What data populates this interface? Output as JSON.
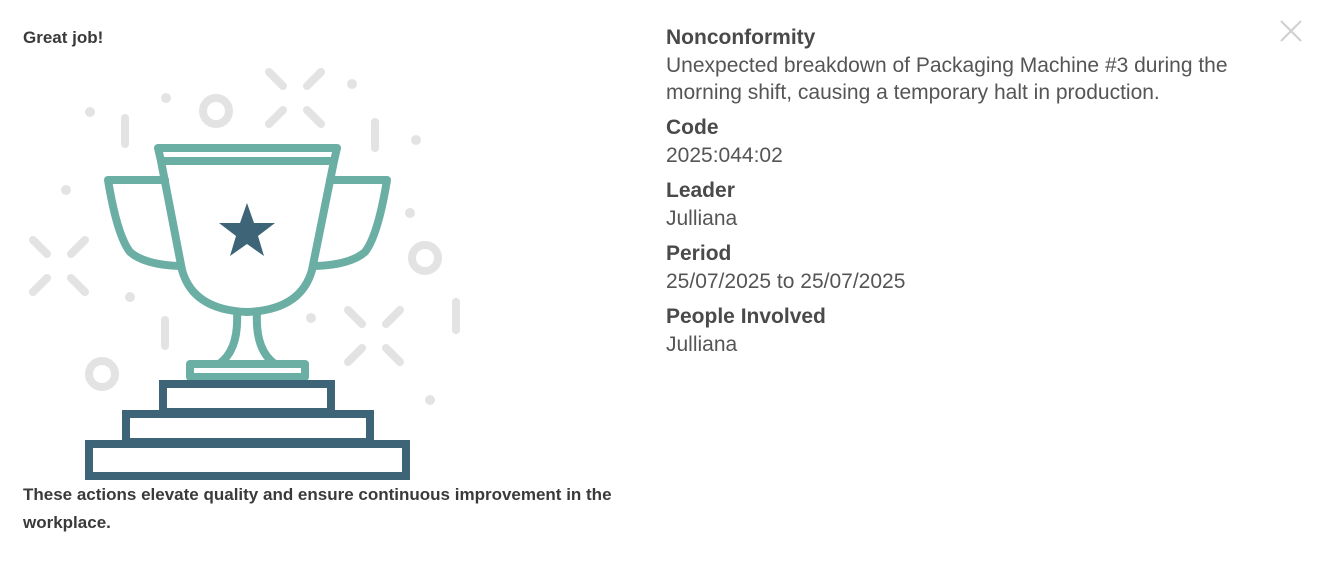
{
  "modal": {
    "headline": "Great job!",
    "footer_text": "These actions elevate quality and ensure continuous improvement in the workplace.",
    "close_icon": "close-icon",
    "trophy_icon": "trophy-icon"
  },
  "details": {
    "nonconformity_label": "Nonconformity",
    "nonconformity_value": "Unexpected breakdown of Packaging Machine #3 during the morning shift, causing a temporary halt in production.",
    "code_label": "Code",
    "code_value": "2025:044:02",
    "leader_label": "Leader",
    "leader_value": "Julliana",
    "period_label": "Period",
    "period_value": "25/07/2025 to 25/07/2025",
    "people_label": "People Involved",
    "people_value": "Julliana"
  },
  "colors": {
    "trophy_cup": "#6aaea4",
    "trophy_base": "#3d6577",
    "confetti": "#e3e3e3",
    "text_dark": "#3a3a3a",
    "close": "#cfcfcf"
  }
}
